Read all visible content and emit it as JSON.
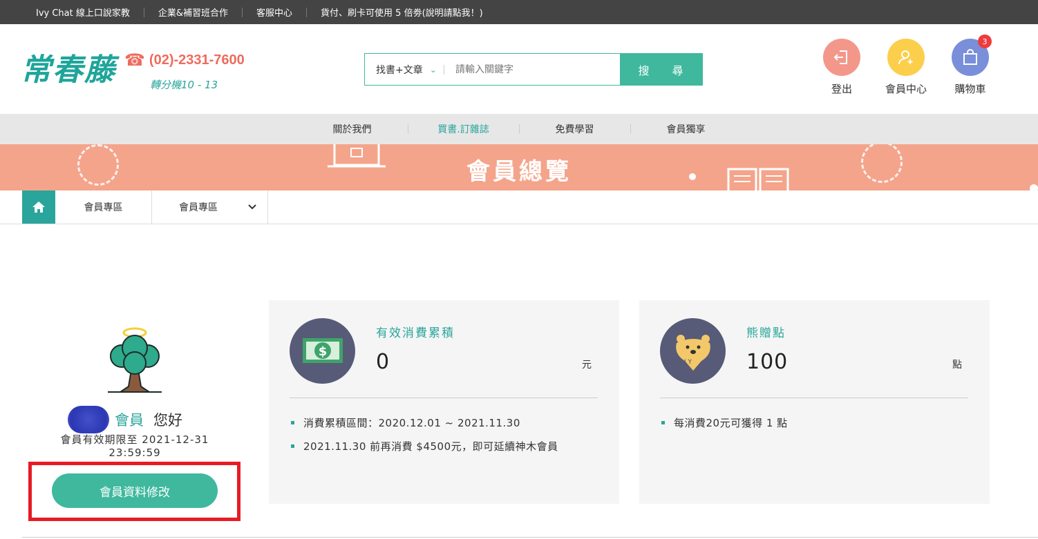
{
  "topbar": {
    "links": [
      "Ivy Chat 線上口說家教",
      "企業&補習班合作",
      "客服中心",
      "貨付、刷卡可使用 5 倍劵(說明請點我！)"
    ]
  },
  "header": {
    "logo_text": "常春藤",
    "phone": "(02)-2331-7600",
    "extension": "轉分機10 - 13",
    "search": {
      "category": "找書+文章",
      "placeholder": "請輸入關鍵字",
      "button": "搜 尋"
    },
    "icons": {
      "logout": "登出",
      "member_center": "會員中心",
      "cart": "購物車",
      "cart_count": "3"
    },
    "icon_colors": {
      "logout": "#f4978b",
      "member": "#fbcf4c",
      "cart": "#7a8fd9"
    }
  },
  "nav": {
    "items": [
      "關於我們",
      "買書.訂雜誌",
      "免費學習",
      "會員獨享"
    ]
  },
  "banner": {
    "title": "會員總覽"
  },
  "breadcrumb": {
    "items": [
      "會員專區",
      "會員專區"
    ]
  },
  "profile": {
    "member_label": "會員",
    "greeting": "您好",
    "valid_line1": "會員有效期限至 2021-12-31",
    "valid_line2": "23:59:59",
    "edit_button": "會員資料修改"
  },
  "cards": {
    "spend": {
      "title": "有效消費累積",
      "value": "0",
      "unit": "元",
      "notes": [
        "消費累積區間：2020.12.01 ~ 2021.11.30",
        "2021.11.30 前再消費 $4500元，即可延續神木會員"
      ]
    },
    "points": {
      "title": "熊贈點",
      "value": "100",
      "unit": "點",
      "notes": [
        "每消費20元可獲得 1 點"
      ]
    }
  },
  "colors": {
    "accent": "#3fb89e",
    "banner": "#f4a48b",
    "highlight": "#e61c24"
  }
}
